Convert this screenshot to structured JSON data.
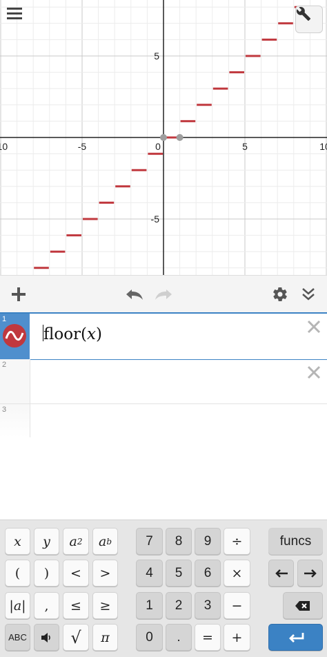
{
  "graph": {
    "x_tick_labels": [
      "-10",
      "-5",
      "0",
      "5",
      "10"
    ],
    "y_tick_labels": [
      "5",
      "-5"
    ],
    "curve_color": "#c0383e",
    "open_point_color": "#9e9e9e",
    "step_values": [
      -8,
      -7,
      -6,
      -5,
      -4,
      -3,
      -2,
      -1,
      0,
      1,
      2,
      3,
      4,
      5,
      6,
      7,
      8
    ]
  },
  "toolbar": {
    "add_icon": "plus-icon",
    "undo_icon": "undo-icon",
    "redo_icon": "redo-icon",
    "settings_icon": "gear-icon",
    "collapse_icon": "double-chevron-down-icon"
  },
  "expressions": [
    {
      "index": "1",
      "fn": "floor",
      "arg": "x",
      "color": "#c0383e",
      "active": true
    },
    {
      "index": "2",
      "text": ""
    },
    {
      "index": "3",
      "text": ""
    }
  ],
  "keyboard": {
    "funcs_label": "funcs",
    "abc_label": "ABC",
    "left_keys": [
      "x",
      "y",
      "a",
      "a",
      "(",
      ")",
      "<",
      ">",
      "|a|",
      ",",
      "≤",
      "≥",
      "√",
      "π"
    ],
    "numpad": [
      "7",
      "8",
      "9",
      "÷",
      "4",
      "5",
      "6",
      "×",
      "1",
      "2",
      "3",
      "−",
      "0",
      ".",
      "=",
      "+"
    ]
  }
}
